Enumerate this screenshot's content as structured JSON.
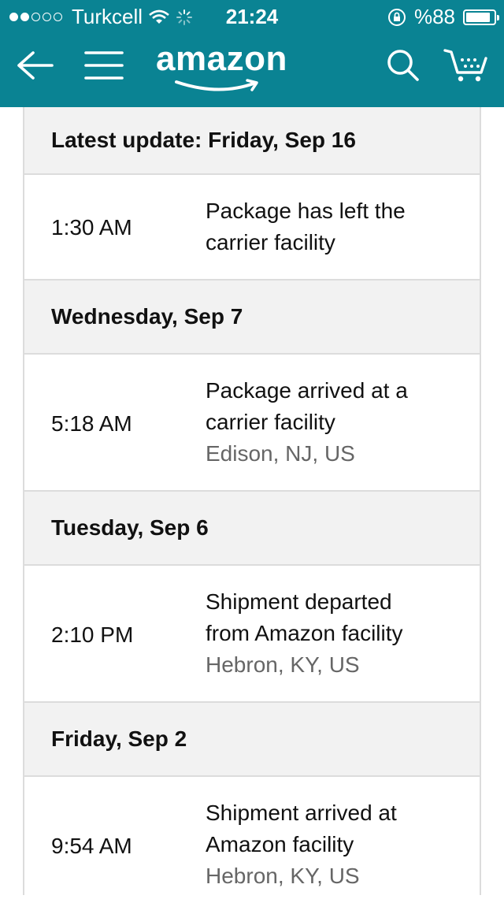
{
  "status_bar": {
    "carrier": "Turkcell",
    "time": "21:24",
    "battery": "%88",
    "battery_level": 0.88
  },
  "header": {
    "brand": "amazon",
    "colors": {
      "bar": "#0a8393"
    },
    "icons": [
      "back-arrow-icon",
      "hamburger-menu-icon",
      "search-icon",
      "cart-icon"
    ]
  },
  "tracking": {
    "groups": [
      {
        "date": "Latest update: Friday, Sep 16",
        "time": "1:30 AM",
        "desc1": "Package has left the",
        "desc2": "carrier facility",
        "location": ""
      },
      {
        "date": "Wednesday, Sep 7",
        "time": "5:18 AM",
        "desc1": "Package arrived at a",
        "desc2": "carrier facility",
        "location": "Edison, NJ, US"
      },
      {
        "date": "Tuesday, Sep 6",
        "time": "2:10 PM",
        "desc1": "Shipment departed",
        "desc2": "from Amazon facility",
        "location": "Hebron, KY, US"
      },
      {
        "date": "Friday, Sep 2",
        "time": "9:54 AM",
        "desc1": "Shipment arrived at",
        "desc2": "Amazon facility",
        "location": "Hebron, KY, US"
      }
    ]
  }
}
